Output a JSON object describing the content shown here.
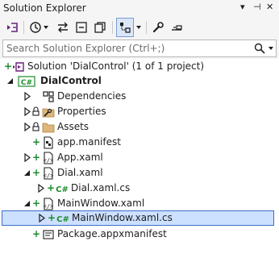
{
  "window": {
    "title": "Solution Explorer",
    "ctrl_dropdown": "▾",
    "ctrl_pin": "⊣",
    "ctrl_close": "✕"
  },
  "search": {
    "placeholder": "Search Solution Explorer (Ctrl+;)"
  },
  "tree": {
    "items": [
      {
        "label": "Solution 'DialControl' (1 of 1 project)",
        "icon": "solution-icon",
        "state": "none",
        "check": true
      },
      {
        "label": "DialControl",
        "icon": "csharp-project-icon",
        "state": "expanded",
        "check": false
      },
      {
        "label": "Dependencies",
        "icon": "dependencies-icon",
        "state": "collapsed",
        "check": false
      },
      {
        "label": "Properties",
        "icon": "properties-folder-icon",
        "state": "collapsed",
        "check": false
      },
      {
        "label": "Assets",
        "icon": "folder-icon",
        "state": "collapsed",
        "check": false
      },
      {
        "label": "app.manifest",
        "icon": "manifest-icon",
        "state": "none",
        "check": true
      },
      {
        "label": "App.xaml",
        "icon": "xaml-icon",
        "state": "collapsed",
        "check": true
      },
      {
        "label": "Dial.xaml",
        "icon": "xaml-icon",
        "state": "expanded",
        "check": true
      },
      {
        "label": "Dial.xaml.cs",
        "icon": "csharp-file-icon",
        "state": "collapsed",
        "check": true
      },
      {
        "label": "MainWindow.xaml",
        "icon": "xaml-icon",
        "state": "expanded",
        "check": true
      },
      {
        "label": "MainWindow.xaml.cs",
        "icon": "csharp-file-icon",
        "state": "collapsed",
        "check": true,
        "selected": true
      },
      {
        "label": "Package.appxmanifest",
        "icon": "package-manifest-icon",
        "state": "none",
        "check": true
      }
    ]
  }
}
